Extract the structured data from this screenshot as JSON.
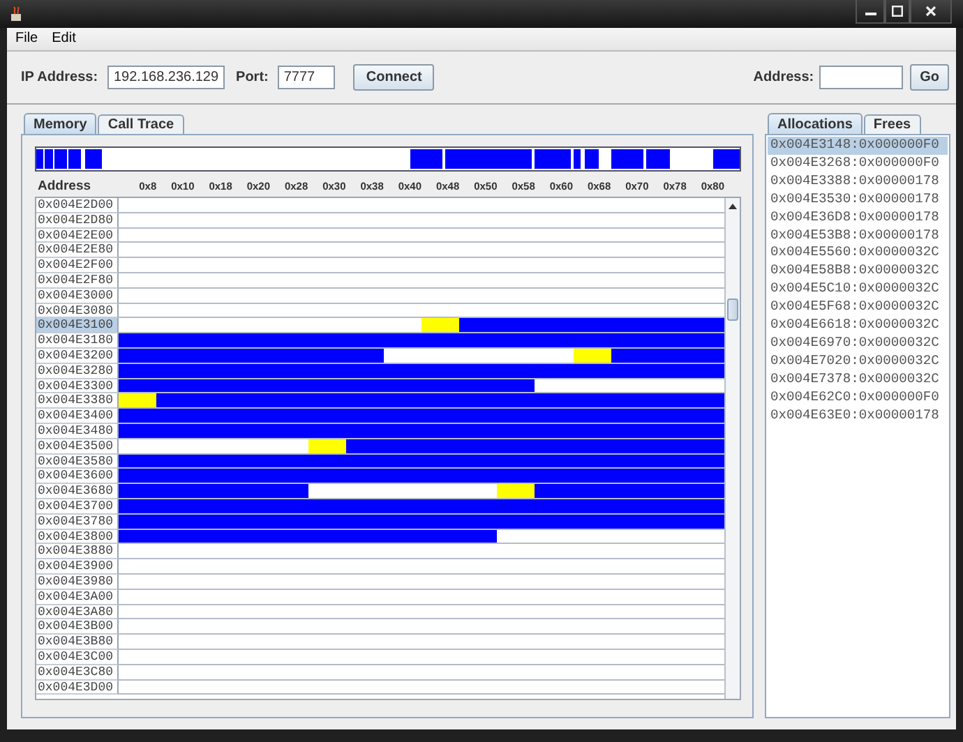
{
  "menu": [
    {
      "label": "File"
    },
    {
      "label": "Edit"
    }
  ],
  "toolbar": {
    "ip_label": "IP Address:",
    "ip_value": "192.168.236.129",
    "port_label": "Port:",
    "port_value": "7777",
    "connect": "Connect",
    "address_label": "Address:",
    "go": "Go"
  },
  "memory_tabs": [
    {
      "label": "Memory",
      "selected": true
    },
    {
      "label": "Call Trace",
      "selected": false
    }
  ],
  "memory_table": {
    "columns": [
      "Address",
      "0x8",
      "0x10",
      "0x18",
      "0x20",
      "0x28",
      "0x30",
      "0x38",
      "0x40",
      "0x48",
      "0x50",
      "0x58",
      "0x60",
      "0x68",
      "0x70",
      "0x78",
      "0x80"
    ],
    "rows": [
      {
        "address": "0x004E2D00",
        "selected": false,
        "cells": [
          {
            "kind": "free"
          },
          {
            "kind": "free"
          },
          {
            "kind": "free"
          },
          {
            "kind": "free"
          },
          {
            "kind": "free"
          },
          {
            "kind": "free"
          },
          {
            "kind": "free"
          },
          {
            "kind": "free"
          },
          {
            "kind": "free"
          },
          {
            "kind": "free"
          },
          {
            "kind": "free"
          },
          {
            "kind": "free"
          },
          {
            "kind": "free"
          },
          {
            "kind": "free"
          },
          {
            "kind": "free"
          },
          {
            "kind": "free"
          }
        ]
      },
      {
        "address": "0x004E2D80",
        "selected": false,
        "cells": [
          {
            "kind": "free"
          },
          {
            "kind": "free"
          },
          {
            "kind": "free"
          },
          {
            "kind": "free"
          },
          {
            "kind": "free"
          },
          {
            "kind": "free"
          },
          {
            "kind": "free"
          },
          {
            "kind": "free"
          },
          {
            "kind": "free"
          },
          {
            "kind": "free"
          },
          {
            "kind": "free"
          },
          {
            "kind": "free"
          },
          {
            "kind": "free"
          },
          {
            "kind": "free"
          },
          {
            "kind": "free"
          },
          {
            "kind": "free"
          }
        ]
      },
      {
        "address": "0x004E2E00",
        "selected": false,
        "cells": [
          {
            "kind": "free"
          },
          {
            "kind": "free"
          },
          {
            "kind": "free"
          },
          {
            "kind": "free"
          },
          {
            "kind": "free"
          },
          {
            "kind": "free"
          },
          {
            "kind": "free"
          },
          {
            "kind": "free"
          },
          {
            "kind": "free"
          },
          {
            "kind": "free"
          },
          {
            "kind": "free"
          },
          {
            "kind": "free"
          },
          {
            "kind": "free"
          },
          {
            "kind": "free"
          },
          {
            "kind": "free"
          },
          {
            "kind": "free"
          }
        ]
      },
      {
        "address": "0x004E2E80",
        "selected": false,
        "cells": [
          {
            "kind": "free"
          },
          {
            "kind": "free"
          },
          {
            "kind": "free"
          },
          {
            "kind": "free"
          },
          {
            "kind": "free"
          },
          {
            "kind": "free"
          },
          {
            "kind": "free"
          },
          {
            "kind": "free"
          },
          {
            "kind": "free"
          },
          {
            "kind": "free"
          },
          {
            "kind": "free"
          },
          {
            "kind": "free"
          },
          {
            "kind": "free"
          },
          {
            "kind": "free"
          },
          {
            "kind": "free"
          },
          {
            "kind": "free"
          }
        ]
      },
      {
        "address": "0x004E2F00",
        "selected": false,
        "cells": [
          {
            "kind": "free"
          },
          {
            "kind": "free"
          },
          {
            "kind": "free"
          },
          {
            "kind": "free"
          },
          {
            "kind": "free"
          },
          {
            "kind": "free"
          },
          {
            "kind": "free"
          },
          {
            "kind": "free"
          },
          {
            "kind": "free"
          },
          {
            "kind": "free"
          },
          {
            "kind": "free"
          },
          {
            "kind": "free"
          },
          {
            "kind": "free"
          },
          {
            "kind": "free"
          },
          {
            "kind": "free"
          },
          {
            "kind": "free"
          }
        ]
      },
      {
        "address": "0x004E2F80",
        "selected": false,
        "cells": [
          {
            "kind": "free"
          },
          {
            "kind": "free"
          },
          {
            "kind": "free"
          },
          {
            "kind": "free"
          },
          {
            "kind": "free"
          },
          {
            "kind": "free"
          },
          {
            "kind": "free"
          },
          {
            "kind": "free"
          },
          {
            "kind": "free"
          },
          {
            "kind": "free"
          },
          {
            "kind": "free"
          },
          {
            "kind": "free"
          },
          {
            "kind": "free"
          },
          {
            "kind": "free"
          },
          {
            "kind": "free"
          },
          {
            "kind": "free"
          }
        ]
      },
      {
        "address": "0x004E3000",
        "selected": false,
        "cells": [
          {
            "kind": "free"
          },
          {
            "kind": "free"
          },
          {
            "kind": "free"
          },
          {
            "kind": "free"
          },
          {
            "kind": "free"
          },
          {
            "kind": "free"
          },
          {
            "kind": "free"
          },
          {
            "kind": "free"
          },
          {
            "kind": "free"
          },
          {
            "kind": "free"
          },
          {
            "kind": "free"
          },
          {
            "kind": "free"
          },
          {
            "kind": "free"
          },
          {
            "kind": "free"
          },
          {
            "kind": "free"
          },
          {
            "kind": "free"
          }
        ]
      },
      {
        "address": "0x004E3080",
        "selected": false,
        "cells": [
          {
            "kind": "free"
          },
          {
            "kind": "free"
          },
          {
            "kind": "free"
          },
          {
            "kind": "free"
          },
          {
            "kind": "free"
          },
          {
            "kind": "free"
          },
          {
            "kind": "free"
          },
          {
            "kind": "free"
          },
          {
            "kind": "free"
          },
          {
            "kind": "free"
          },
          {
            "kind": "free"
          },
          {
            "kind": "free"
          },
          {
            "kind": "free"
          },
          {
            "kind": "free"
          },
          {
            "kind": "free"
          },
          {
            "kind": "free"
          }
        ]
      },
      {
        "address": "0x004E3100",
        "selected": true,
        "cells": [
          {
            "kind": "free"
          },
          {
            "kind": "free"
          },
          {
            "kind": "free"
          },
          {
            "kind": "free"
          },
          {
            "kind": "free"
          },
          {
            "kind": "free"
          },
          {
            "kind": "free"
          },
          {
            "kind": "free"
          },
          {
            "kind": "header"
          },
          {
            "kind": "used"
          },
          {
            "kind": "used"
          },
          {
            "kind": "used"
          },
          {
            "kind": "used"
          },
          {
            "kind": "used"
          },
          {
            "kind": "used"
          },
          {
            "kind": "used"
          }
        ]
      },
      {
        "address": "0x004E3180",
        "selected": false,
        "cells": [
          {
            "kind": "used"
          },
          {
            "kind": "used"
          },
          {
            "kind": "used"
          },
          {
            "kind": "used"
          },
          {
            "kind": "used"
          },
          {
            "kind": "used"
          },
          {
            "kind": "used"
          },
          {
            "kind": "used"
          },
          {
            "kind": "used"
          },
          {
            "kind": "used"
          },
          {
            "kind": "used"
          },
          {
            "kind": "used"
          },
          {
            "kind": "used"
          },
          {
            "kind": "used"
          },
          {
            "kind": "used"
          },
          {
            "kind": "used"
          }
        ]
      },
      {
        "address": "0x004E3200",
        "selected": false,
        "cells": [
          {
            "kind": "used"
          },
          {
            "kind": "used"
          },
          {
            "kind": "used"
          },
          {
            "kind": "used"
          },
          {
            "kind": "used"
          },
          {
            "kind": "used"
          },
          {
            "kind": "used"
          },
          {
            "kind": "free"
          },
          {
            "kind": "free"
          },
          {
            "kind": "free"
          },
          {
            "kind": "free"
          },
          {
            "kind": "free"
          },
          {
            "kind": "header"
          },
          {
            "kind": "used"
          },
          {
            "kind": "used"
          },
          {
            "kind": "used"
          }
        ]
      },
      {
        "address": "0x004E3280",
        "selected": false,
        "cells": [
          {
            "kind": "used"
          },
          {
            "kind": "used"
          },
          {
            "kind": "used"
          },
          {
            "kind": "used"
          },
          {
            "kind": "used"
          },
          {
            "kind": "used"
          },
          {
            "kind": "used"
          },
          {
            "kind": "used"
          },
          {
            "kind": "used"
          },
          {
            "kind": "used"
          },
          {
            "kind": "used"
          },
          {
            "kind": "used"
          },
          {
            "kind": "used"
          },
          {
            "kind": "used"
          },
          {
            "kind": "used"
          },
          {
            "kind": "used"
          }
        ]
      },
      {
        "address": "0x004E3300",
        "selected": false,
        "cells": [
          {
            "kind": "used"
          },
          {
            "kind": "used"
          },
          {
            "kind": "used"
          },
          {
            "kind": "used"
          },
          {
            "kind": "used"
          },
          {
            "kind": "used"
          },
          {
            "kind": "used"
          },
          {
            "kind": "used"
          },
          {
            "kind": "used"
          },
          {
            "kind": "used"
          },
          {
            "kind": "used"
          },
          {
            "kind": "free"
          },
          {
            "kind": "free"
          },
          {
            "kind": "free"
          },
          {
            "kind": "free"
          },
          {
            "kind": "free"
          }
        ]
      },
      {
        "address": "0x004E3380",
        "selected": false,
        "cells": [
          {
            "kind": "header"
          },
          {
            "kind": "used"
          },
          {
            "kind": "used"
          },
          {
            "kind": "used"
          },
          {
            "kind": "used"
          },
          {
            "kind": "used"
          },
          {
            "kind": "used"
          },
          {
            "kind": "used"
          },
          {
            "kind": "used"
          },
          {
            "kind": "used"
          },
          {
            "kind": "used"
          },
          {
            "kind": "used"
          },
          {
            "kind": "used"
          },
          {
            "kind": "used"
          },
          {
            "kind": "used"
          },
          {
            "kind": "used"
          }
        ]
      },
      {
        "address": "0x004E3400",
        "selected": false,
        "cells": [
          {
            "kind": "used"
          },
          {
            "kind": "used"
          },
          {
            "kind": "used"
          },
          {
            "kind": "used"
          },
          {
            "kind": "used"
          },
          {
            "kind": "used"
          },
          {
            "kind": "used"
          },
          {
            "kind": "used"
          },
          {
            "kind": "used"
          },
          {
            "kind": "used"
          },
          {
            "kind": "used"
          },
          {
            "kind": "used"
          },
          {
            "kind": "used"
          },
          {
            "kind": "used"
          },
          {
            "kind": "used"
          },
          {
            "kind": "used"
          }
        ]
      },
      {
        "address": "0x004E3480",
        "selected": false,
        "cells": [
          {
            "kind": "used"
          },
          {
            "kind": "used"
          },
          {
            "kind": "used"
          },
          {
            "kind": "used"
          },
          {
            "kind": "used"
          },
          {
            "kind": "used"
          },
          {
            "kind": "used"
          },
          {
            "kind": "used"
          },
          {
            "kind": "used"
          },
          {
            "kind": "used"
          },
          {
            "kind": "used"
          },
          {
            "kind": "used"
          },
          {
            "kind": "used"
          },
          {
            "kind": "used"
          },
          {
            "kind": "used"
          },
          {
            "kind": "used"
          }
        ]
      },
      {
        "address": "0x004E3500",
        "selected": false,
        "cells": [
          {
            "kind": "free"
          },
          {
            "kind": "free"
          },
          {
            "kind": "free"
          },
          {
            "kind": "free"
          },
          {
            "kind": "free"
          },
          {
            "kind": "header"
          },
          {
            "kind": "used"
          },
          {
            "kind": "used"
          },
          {
            "kind": "used"
          },
          {
            "kind": "used"
          },
          {
            "kind": "used"
          },
          {
            "kind": "used"
          },
          {
            "kind": "used"
          },
          {
            "kind": "used"
          },
          {
            "kind": "used"
          },
          {
            "kind": "used"
          }
        ]
      },
      {
        "address": "0x004E3580",
        "selected": false,
        "cells": [
          {
            "kind": "used"
          },
          {
            "kind": "used"
          },
          {
            "kind": "used"
          },
          {
            "kind": "used"
          },
          {
            "kind": "used"
          },
          {
            "kind": "used"
          },
          {
            "kind": "used"
          },
          {
            "kind": "used"
          },
          {
            "kind": "used"
          },
          {
            "kind": "used"
          },
          {
            "kind": "used"
          },
          {
            "kind": "used"
          },
          {
            "kind": "used"
          },
          {
            "kind": "used"
          },
          {
            "kind": "used"
          },
          {
            "kind": "used"
          }
        ]
      },
      {
        "address": "0x004E3600",
        "selected": false,
        "cells": [
          {
            "kind": "used"
          },
          {
            "kind": "used"
          },
          {
            "kind": "used"
          },
          {
            "kind": "used"
          },
          {
            "kind": "used"
          },
          {
            "kind": "used"
          },
          {
            "kind": "used"
          },
          {
            "kind": "used"
          },
          {
            "kind": "used"
          },
          {
            "kind": "used"
          },
          {
            "kind": "used"
          },
          {
            "kind": "used"
          },
          {
            "kind": "used"
          },
          {
            "kind": "used"
          },
          {
            "kind": "used"
          },
          {
            "kind": "used"
          }
        ]
      },
      {
        "address": "0x004E3680",
        "selected": false,
        "cells": [
          {
            "kind": "used"
          },
          {
            "kind": "used"
          },
          {
            "kind": "used"
          },
          {
            "kind": "used"
          },
          {
            "kind": "used"
          },
          {
            "kind": "free"
          },
          {
            "kind": "free"
          },
          {
            "kind": "free"
          },
          {
            "kind": "free"
          },
          {
            "kind": "free"
          },
          {
            "kind": "header"
          },
          {
            "kind": "used"
          },
          {
            "kind": "used"
          },
          {
            "kind": "used"
          },
          {
            "kind": "used"
          },
          {
            "kind": "used"
          }
        ]
      },
      {
        "address": "0x004E3700",
        "selected": false,
        "cells": [
          {
            "kind": "used"
          },
          {
            "kind": "used"
          },
          {
            "kind": "used"
          },
          {
            "kind": "used"
          },
          {
            "kind": "used"
          },
          {
            "kind": "used"
          },
          {
            "kind": "used"
          },
          {
            "kind": "used"
          },
          {
            "kind": "used"
          },
          {
            "kind": "used"
          },
          {
            "kind": "used"
          },
          {
            "kind": "used"
          },
          {
            "kind": "used"
          },
          {
            "kind": "used"
          },
          {
            "kind": "used"
          },
          {
            "kind": "used"
          }
        ]
      },
      {
        "address": "0x004E3780",
        "selected": false,
        "cells": [
          {
            "kind": "used"
          },
          {
            "kind": "used"
          },
          {
            "kind": "used"
          },
          {
            "kind": "used"
          },
          {
            "kind": "used"
          },
          {
            "kind": "used"
          },
          {
            "kind": "used"
          },
          {
            "kind": "used"
          },
          {
            "kind": "used"
          },
          {
            "kind": "used"
          },
          {
            "kind": "used"
          },
          {
            "kind": "used"
          },
          {
            "kind": "used"
          },
          {
            "kind": "used"
          },
          {
            "kind": "used"
          },
          {
            "kind": "used"
          }
        ]
      },
      {
        "address": "0x004E3800",
        "selected": false,
        "cells": [
          {
            "kind": "used"
          },
          {
            "kind": "used"
          },
          {
            "kind": "used"
          },
          {
            "kind": "used"
          },
          {
            "kind": "used"
          },
          {
            "kind": "used"
          },
          {
            "kind": "used"
          },
          {
            "kind": "used"
          },
          {
            "kind": "used"
          },
          {
            "kind": "used"
          },
          {
            "kind": "free"
          },
          {
            "kind": "free"
          },
          {
            "kind": "free"
          },
          {
            "kind": "free"
          },
          {
            "kind": "free"
          },
          {
            "kind": "free"
          }
        ]
      },
      {
        "address": "0x004E3880",
        "selected": false,
        "cells": [
          {
            "kind": "free"
          },
          {
            "kind": "free"
          },
          {
            "kind": "free"
          },
          {
            "kind": "free"
          },
          {
            "kind": "free"
          },
          {
            "kind": "free"
          },
          {
            "kind": "free"
          },
          {
            "kind": "free"
          },
          {
            "kind": "free"
          },
          {
            "kind": "free"
          },
          {
            "kind": "free"
          },
          {
            "kind": "free"
          },
          {
            "kind": "free"
          },
          {
            "kind": "free"
          },
          {
            "kind": "free"
          },
          {
            "kind": "free"
          }
        ]
      },
      {
        "address": "0x004E3900",
        "selected": false,
        "cells": [
          {
            "kind": "free"
          },
          {
            "kind": "free"
          },
          {
            "kind": "free"
          },
          {
            "kind": "free"
          },
          {
            "kind": "free"
          },
          {
            "kind": "free"
          },
          {
            "kind": "free"
          },
          {
            "kind": "free"
          },
          {
            "kind": "free"
          },
          {
            "kind": "free"
          },
          {
            "kind": "free"
          },
          {
            "kind": "free"
          },
          {
            "kind": "free"
          },
          {
            "kind": "free"
          },
          {
            "kind": "free"
          },
          {
            "kind": "free"
          }
        ]
      },
      {
        "address": "0x004E3980",
        "selected": false,
        "cells": [
          {
            "kind": "free"
          },
          {
            "kind": "free"
          },
          {
            "kind": "free"
          },
          {
            "kind": "free"
          },
          {
            "kind": "free"
          },
          {
            "kind": "free"
          },
          {
            "kind": "free"
          },
          {
            "kind": "free"
          },
          {
            "kind": "free"
          },
          {
            "kind": "free"
          },
          {
            "kind": "free"
          },
          {
            "kind": "free"
          },
          {
            "kind": "free"
          },
          {
            "kind": "free"
          },
          {
            "kind": "free"
          },
          {
            "kind": "free"
          }
        ]
      },
      {
        "address": "0x004E3A00",
        "selected": false,
        "cells": [
          {
            "kind": "free"
          },
          {
            "kind": "free"
          },
          {
            "kind": "free"
          },
          {
            "kind": "free"
          },
          {
            "kind": "free"
          },
          {
            "kind": "free"
          },
          {
            "kind": "free"
          },
          {
            "kind": "free"
          },
          {
            "kind": "free"
          },
          {
            "kind": "free"
          },
          {
            "kind": "free"
          },
          {
            "kind": "free"
          },
          {
            "kind": "free"
          },
          {
            "kind": "free"
          },
          {
            "kind": "free"
          },
          {
            "kind": "free"
          }
        ]
      },
      {
        "address": "0x004E3A80",
        "selected": false,
        "cells": [
          {
            "kind": "free"
          },
          {
            "kind": "free"
          },
          {
            "kind": "free"
          },
          {
            "kind": "free"
          },
          {
            "kind": "free"
          },
          {
            "kind": "free"
          },
          {
            "kind": "free"
          },
          {
            "kind": "free"
          },
          {
            "kind": "free"
          },
          {
            "kind": "free"
          },
          {
            "kind": "free"
          },
          {
            "kind": "free"
          },
          {
            "kind": "free"
          },
          {
            "kind": "free"
          },
          {
            "kind": "free"
          },
          {
            "kind": "free"
          }
        ]
      },
      {
        "address": "0x004E3B00",
        "selected": false,
        "cells": [
          {
            "kind": "free"
          },
          {
            "kind": "free"
          },
          {
            "kind": "free"
          },
          {
            "kind": "free"
          },
          {
            "kind": "free"
          },
          {
            "kind": "free"
          },
          {
            "kind": "free"
          },
          {
            "kind": "free"
          },
          {
            "kind": "free"
          },
          {
            "kind": "free"
          },
          {
            "kind": "free"
          },
          {
            "kind": "free"
          },
          {
            "kind": "free"
          },
          {
            "kind": "free"
          },
          {
            "kind": "free"
          },
          {
            "kind": "free"
          }
        ]
      },
      {
        "address": "0x004E3B80",
        "selected": false,
        "cells": [
          {
            "kind": "free"
          },
          {
            "kind": "free"
          },
          {
            "kind": "free"
          },
          {
            "kind": "free"
          },
          {
            "kind": "free"
          },
          {
            "kind": "free"
          },
          {
            "kind": "free"
          },
          {
            "kind": "free"
          },
          {
            "kind": "free"
          },
          {
            "kind": "free"
          },
          {
            "kind": "free"
          },
          {
            "kind": "free"
          },
          {
            "kind": "free"
          },
          {
            "kind": "free"
          },
          {
            "kind": "free"
          },
          {
            "kind": "free"
          }
        ]
      },
      {
        "address": "0x004E3C00",
        "selected": false,
        "cells": [
          {
            "kind": "free"
          },
          {
            "kind": "free"
          },
          {
            "kind": "free"
          },
          {
            "kind": "free"
          },
          {
            "kind": "free"
          },
          {
            "kind": "free"
          },
          {
            "kind": "free"
          },
          {
            "kind": "free"
          },
          {
            "kind": "free"
          },
          {
            "kind": "free"
          },
          {
            "kind": "free"
          },
          {
            "kind": "free"
          },
          {
            "kind": "free"
          },
          {
            "kind": "free"
          },
          {
            "kind": "free"
          },
          {
            "kind": "free"
          }
        ]
      },
      {
        "address": "0x004E3C80",
        "selected": false,
        "cells": [
          {
            "kind": "free"
          },
          {
            "kind": "free"
          },
          {
            "kind": "free"
          },
          {
            "kind": "free"
          },
          {
            "kind": "free"
          },
          {
            "kind": "free"
          },
          {
            "kind": "free"
          },
          {
            "kind": "free"
          },
          {
            "kind": "free"
          },
          {
            "kind": "free"
          },
          {
            "kind": "free"
          },
          {
            "kind": "free"
          },
          {
            "kind": "free"
          },
          {
            "kind": "free"
          },
          {
            "kind": "free"
          },
          {
            "kind": "free"
          }
        ]
      },
      {
        "address": "0x004E3D00",
        "selected": false,
        "cells": [
          {
            "kind": "free"
          },
          {
            "kind": "free"
          },
          {
            "kind": "free"
          },
          {
            "kind": "free"
          },
          {
            "kind": "free"
          },
          {
            "kind": "free"
          },
          {
            "kind": "free"
          },
          {
            "kind": "free"
          },
          {
            "kind": "free"
          },
          {
            "kind": "free"
          },
          {
            "kind": "free"
          },
          {
            "kind": "free"
          },
          {
            "kind": "free"
          },
          {
            "kind": "free"
          },
          {
            "kind": "free"
          },
          {
            "kind": "free"
          }
        ]
      }
    ]
  },
  "side_tabs": [
    {
      "label": "Allocations",
      "selected": true
    },
    {
      "label": "Frees",
      "selected": false
    }
  ],
  "allocations": [
    {
      "text": "0x004E3148:0x000000F0",
      "selected": true
    },
    {
      "text": "0x004E3268:0x000000F0",
      "selected": false
    },
    {
      "text": "0x004E3388:0x00000178",
      "selected": false
    },
    {
      "text": "0x004E3530:0x00000178",
      "selected": false
    },
    {
      "text": "0x004E36D8:0x00000178",
      "selected": false
    },
    {
      "text": "0x004E53B8:0x00000178",
      "selected": false
    },
    {
      "text": "0x004E5560:0x0000032C",
      "selected": false
    },
    {
      "text": "0x004E58B8:0x0000032C",
      "selected": false
    },
    {
      "text": "0x004E5C10:0x0000032C",
      "selected": false
    },
    {
      "text": "0x004E5F68:0x0000032C",
      "selected": false
    },
    {
      "text": "0x004E6618:0x0000032C",
      "selected": false
    },
    {
      "text": "0x004E6970:0x0000032C",
      "selected": false
    },
    {
      "text": "0x004E7020:0x0000032C",
      "selected": false
    },
    {
      "text": "0x004E7378:0x0000032C",
      "selected": false
    },
    {
      "text": "0x004E62C0:0x000000F0",
      "selected": false
    },
    {
      "text": "0x004E63E0:0x00000178",
      "selected": false
    }
  ]
}
